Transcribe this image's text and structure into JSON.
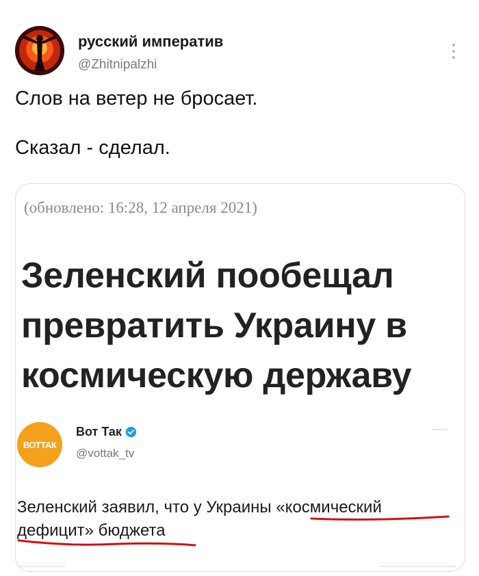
{
  "tweet": {
    "display_name": "русский императив",
    "handle": "@Zhitnipalzhi",
    "text_lines": [
      "Слов на ветер не бросает.",
      "Сказал - сделал."
    ],
    "more_icon": "more-vertical-icon"
  },
  "media": {
    "updated": "(обновлено: 16:28, 12 апреля 2021)",
    "headline_lines": [
      "Зеленский пообещал",
      "превратить Украину в",
      "космическую державу"
    ],
    "embed": {
      "avatar_text": "ВОТТАК",
      "name": "Вот Так",
      "verified_icon": "verified-badge-icon",
      "handle": "@vottak_tv",
      "text_line1_plain": "Зеленский заявил, что у Украины ",
      "text_line1_highlight": "«космический",
      "text_line2_highlight": "дефицит» бюджета"
    }
  },
  "colors": {
    "underline": "#d01010",
    "verified": "#1d9bf0",
    "embed_avatar": "#f5a11c"
  }
}
